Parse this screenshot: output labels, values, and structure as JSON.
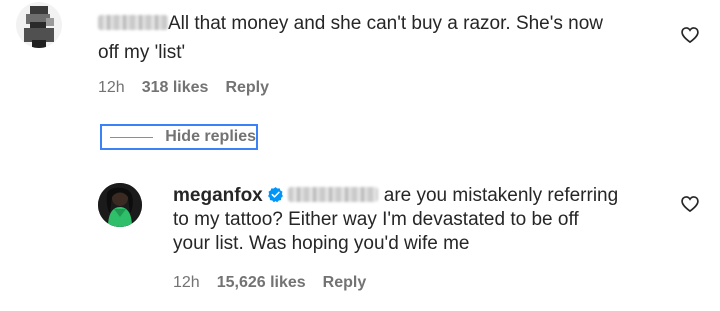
{
  "comments": [
    {
      "text_line1": "All that money and she can't buy a razor. She's now",
      "text_line2": "off my 'list'",
      "time": "12h",
      "likes": "318 likes",
      "reply": "Reply",
      "heart_icon": "heart-outline-icon"
    }
  ],
  "replies_toggle": {
    "label": "Hide replies"
  },
  "reply": {
    "username": "meganfox",
    "verified_icon": "verified-badge-icon",
    "text_line1": "are you mistakenly referring",
    "text_line2": "to my tattoo? Either way I'm devastated to be off",
    "text_line3": "your list. Was hoping you'd wife me",
    "time": "12h",
    "likes": "15,626 likes",
    "reply": "Reply",
    "heart_icon": "heart-outline-icon"
  },
  "colors": {
    "text": "#262626",
    "secondary": "#737373",
    "verified_blue": "#0095f6",
    "highlight_border": "#3b82f6"
  }
}
